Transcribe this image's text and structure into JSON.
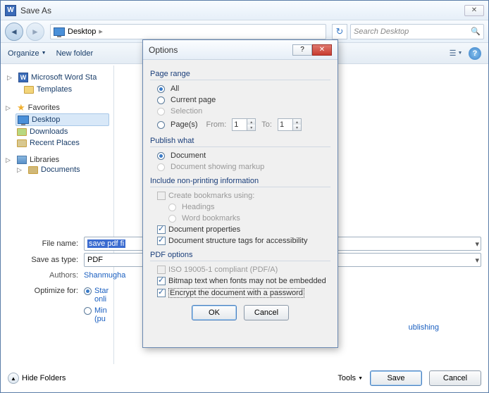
{
  "window": {
    "title": "Save As"
  },
  "nav": {
    "crumb": "Desktop",
    "search_placeholder": "Search Desktop"
  },
  "toolbar": {
    "organize": "Organize",
    "new_folder": "New folder"
  },
  "tree": {
    "word_station": "Microsoft Word Sta",
    "templates": "Templates",
    "favorites": "Favorites",
    "desktop": "Desktop",
    "downloads": "Downloads",
    "recent": "Recent Places",
    "libraries": "Libraries",
    "documents": "Documents"
  },
  "form": {
    "filename_label": "File name:",
    "filename_value": "save pdf fi",
    "saveastype_label": "Save as type:",
    "saveastype_value": "PDF",
    "authors_label": "Authors:",
    "authors_value": "Shanmugha",
    "optimize_label": "Optimize for:",
    "optimize_standard": "Star",
    "optimize_standard2": "onli",
    "optimize_min": "Min",
    "optimize_min2": "(pu",
    "publishing_tail": "ublishing"
  },
  "bottom": {
    "hide_folders": "Hide Folders",
    "tools": "Tools",
    "save": "Save",
    "cancel": "Cancel"
  },
  "dialog": {
    "title": "Options",
    "page_range": "Page range",
    "all": "All",
    "current_page": "Current page",
    "selection": "Selection",
    "pages": "Page(s)",
    "from": "From:",
    "from_val": "1",
    "to": "To:",
    "to_val": "1",
    "publish_what": "Publish what",
    "document": "Document",
    "doc_markup": "Document showing markup",
    "include_nonprint": "Include non-printing information",
    "create_bookmarks": "Create bookmarks using:",
    "headings": "Headings",
    "word_bookmarks": "Word bookmarks",
    "doc_properties": "Document properties",
    "doc_structure": "Document structure tags for accessibility",
    "pdf_options": "PDF options",
    "iso": "ISO 19005-1 compliant (PDF/A)",
    "bitmap": "Bitmap text when fonts may not be embedded",
    "encrypt": "Encrypt the document with a password",
    "ok": "OK",
    "cancel": "Cancel"
  }
}
